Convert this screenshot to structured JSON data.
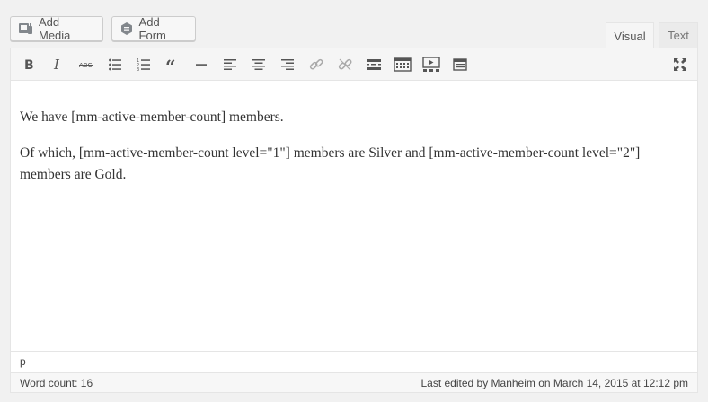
{
  "media_buttons": {
    "add_media": "Add Media",
    "add_form": "Add Form"
  },
  "tabs": {
    "visual": "Visual",
    "text": "Text",
    "active": "Visual"
  },
  "toolbar": {
    "buttons": [
      "bold-icon",
      "italic-icon",
      "strikethrough-icon",
      "bullet-list-icon",
      "numbered-list-icon",
      "blockquote-icon",
      "horizontal-line-icon",
      "align-left-icon",
      "align-center-icon",
      "align-right-icon",
      "insert-link-icon",
      "remove-link-icon",
      "insert-more-icon",
      "toolbar-toggle-icon",
      "media-embed-icon",
      "form-icon",
      "fullscreen-icon"
    ]
  },
  "content": {
    "paragraph1": "We have [mm-active-member-count] members.",
    "paragraph2": "Of which, [mm-active-member-count level=\"1\"] members are Silver and [mm-active-member-count level=\"2\"] members are Gold."
  },
  "path": "p",
  "status": {
    "word_count": "Word count: 16",
    "last_edited": "Last edited by Manheim on March 14, 2015 at 12:12 pm"
  }
}
